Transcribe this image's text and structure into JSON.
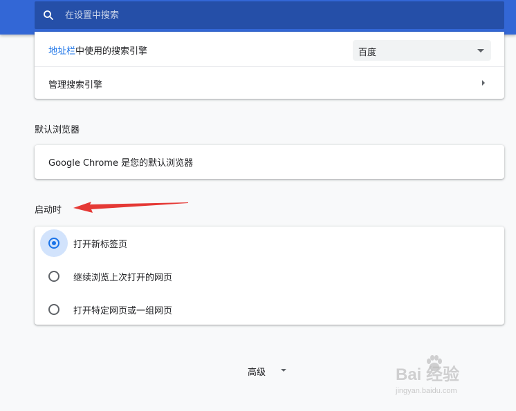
{
  "header": {
    "search_placeholder": "在设置中搜索",
    "icon": "search-icon",
    "bar_color": "#3367d6"
  },
  "search_engine": {
    "address_bar_link": "地址栏",
    "address_bar_rest": "中使用的搜索引擎",
    "selected_engine": "百度",
    "manage_label": "管理搜索引擎"
  },
  "default_browser": {
    "section_title": "默认浏览器",
    "status": "Google Chrome 是您的默认浏览器"
  },
  "startup": {
    "section_title": "启动时",
    "options": [
      {
        "label": "打开新标签页",
        "checked": true
      },
      {
        "label": "继续浏览上次打开的网页",
        "checked": false
      },
      {
        "label": "打开特定网页或一组网页",
        "checked": false
      }
    ]
  },
  "advanced": {
    "label": "高级",
    "icon": "caret-down-icon"
  },
  "annotation": {
    "type": "red-arrow",
    "color": "#e53935",
    "points_to": "启动时"
  },
  "watermark": {
    "main": "Bai 经验",
    "sub": "jingyan.baidu.com"
  },
  "colors": {
    "accent": "#1a73e8",
    "background": "#f8f9fa"
  }
}
